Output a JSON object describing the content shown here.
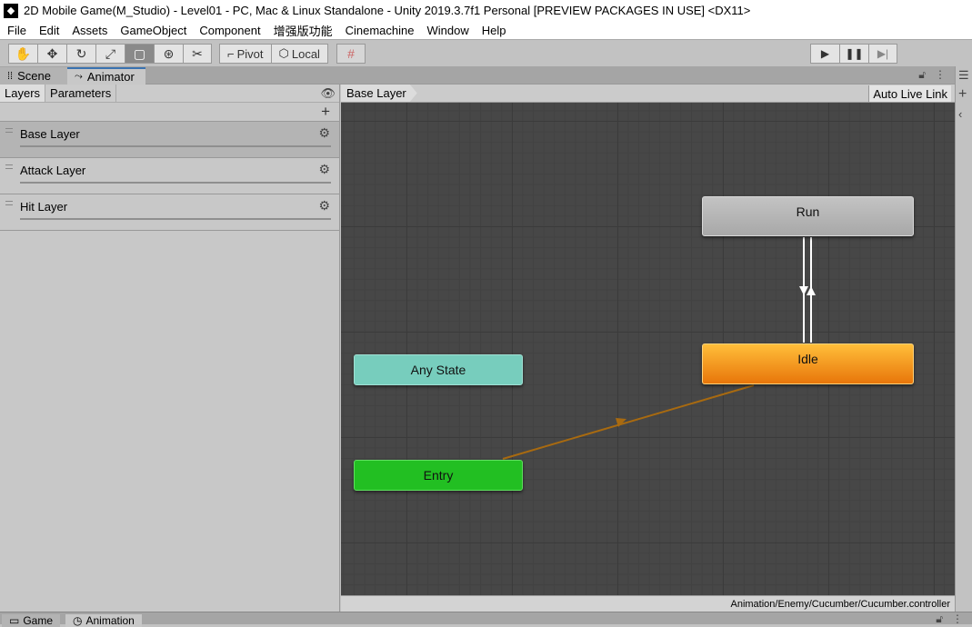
{
  "window": {
    "title": "2D Mobile Game(M_Studio) - Level01 - PC, Mac & Linux Standalone - Unity 2019.3.7f1 Personal [PREVIEW PACKAGES IN USE] <DX11>"
  },
  "menu": {
    "items": [
      "File",
      "Edit",
      "Assets",
      "GameObject",
      "Component",
      "增强版功能",
      "Cinemachine",
      "Window",
      "Help"
    ]
  },
  "toolbar": {
    "pivot_label": "Pivot",
    "local_label": "Local"
  },
  "tabs": {
    "scene": "Scene",
    "animator": "Animator"
  },
  "left_panel": {
    "layers_tab": "Layers",
    "parameters_tab": "Parameters",
    "layers": [
      {
        "name": "Base Layer"
      },
      {
        "name": "Attack Layer"
      },
      {
        "name": "Hit Layer"
      }
    ]
  },
  "graph": {
    "breadcrumb": "Base Layer",
    "auto_live_link": "Auto Live Link",
    "states": {
      "run": "Run",
      "idle": "Idle",
      "any_state": "Any State",
      "entry": "Entry"
    },
    "colors": {
      "idle": "#f08c14",
      "any_state": "#77cdbd",
      "entry": "#22bf22",
      "run": "#b3b3b3",
      "entry_transition": "#a86a10"
    },
    "status_path": "Animation/Enemy/Cucumber/Cucumber.controller"
  },
  "bottom_tabs": {
    "game": "Game",
    "animation": "Animation"
  }
}
